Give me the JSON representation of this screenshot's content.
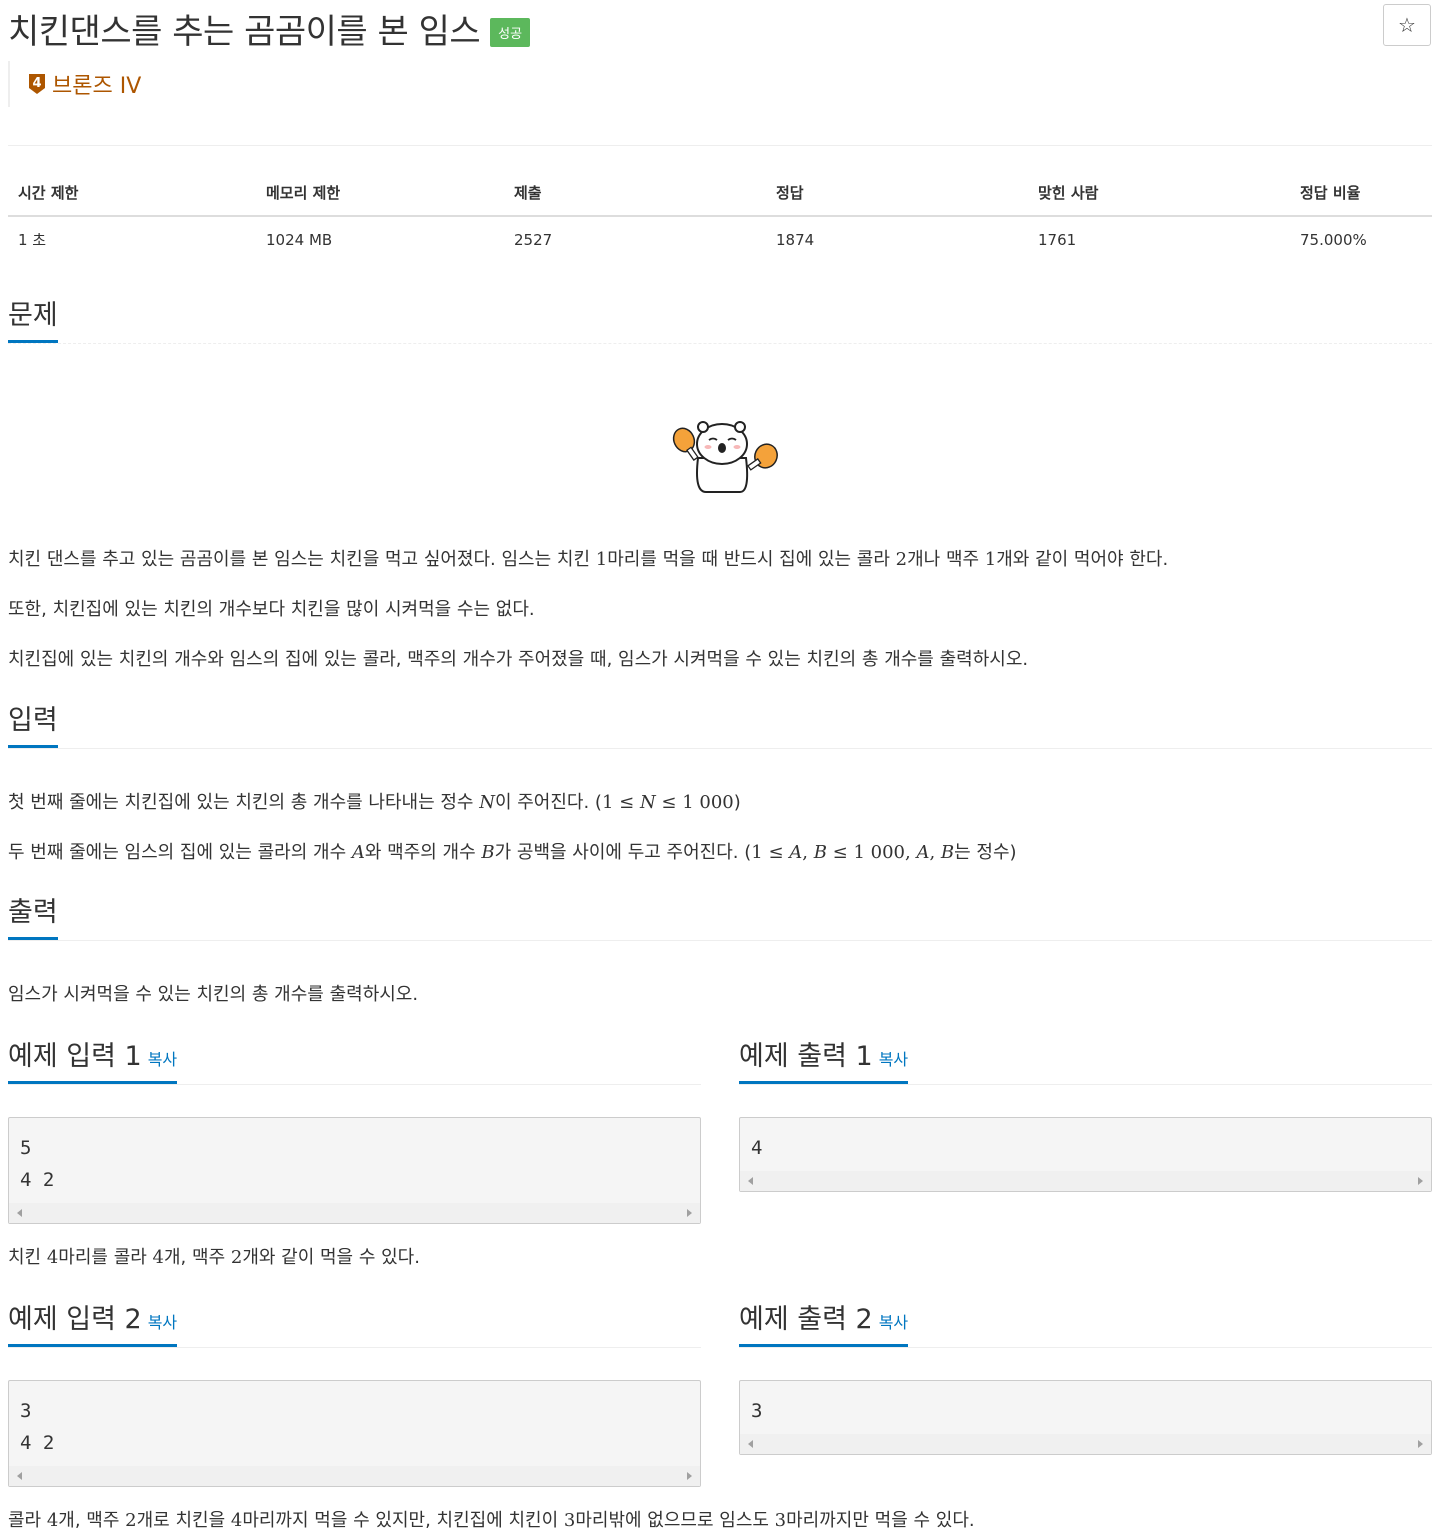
{
  "problem": {
    "title": "치킨댄스를 추는 곰곰이를 본 임스",
    "status_badge": "성공",
    "star_icon": "☆",
    "tier_number": "4",
    "tier_label": "브론즈 IV"
  },
  "stats": {
    "headers": [
      "시간 제한",
      "메모리 제한",
      "제출",
      "정답",
      "맞힌 사람",
      "정답 비율"
    ],
    "values": [
      "1 초",
      "1024 MB",
      "2527",
      "1874",
      "1761",
      "75.000%"
    ]
  },
  "sections": {
    "description_title": "문제",
    "description": {
      "p1a": "치킨 댄스를 추고 있는 곰곰이를 본 임스는 치킨을 먹고 싶어졌다. 임스는 치킨 ",
      "p1b": "1",
      "p1c": "마리를 먹을 때 반드시 집에 있는 콜라 ",
      "p1d": "2",
      "p1e": "개나 맥주 ",
      "p1f": "1",
      "p1g": "개와 같이 먹어야 한다.",
      "p2": "또한, 치킨집에 있는 치킨의 개수보다 치킨을 많이 시켜먹을 수는 없다.",
      "p3": "치킨집에 있는 치킨의 개수와 임스의 집에 있는 콜라, 맥주의 개수가 주어졌을 때, 임스가 시켜먹을 수 있는 치킨의 총 개수를 출력하시오."
    },
    "input_title": "입력",
    "input": {
      "l1a": "첫 번째 줄에는 치킨집에 있는 치킨의 총 개수를 나타내는 정수 ",
      "l1b": "N",
      "l1c": "이 주어진다. (",
      "l1d": "1 ≤ ",
      "l1e": "N",
      "l1f": " ≤ 1 000",
      "l1g": ")",
      "l2a": "두 번째 줄에는 임스의 집에 있는 콜라의 개수 ",
      "l2b": "A",
      "l2c": "와 맥주의 개수 ",
      "l2d": "B",
      "l2e": "가 공백을 사이에 두고 주어진다. (",
      "l2f": "1 ≤ ",
      "l2g": "A",
      "l2h": ", ",
      "l2i": "B",
      "l2j": " ≤ 1 000, ",
      "l2k": "A",
      "l2l": ", ",
      "l2m": "B",
      "l2n": "는 정수)"
    },
    "output_title": "출력",
    "output": "임스가 시켜먹을 수 있는 치킨의 총 개수를 출력하시오."
  },
  "examples": [
    {
      "input_title": "예제 입력 1",
      "output_title": "예제 출력 1",
      "copy_label": "복사",
      "input": "5\n4 2",
      "output": "4",
      "explain_a": "치킨 ",
      "explain_b": "4",
      "explain_c": "마리를 콜라 ",
      "explain_d": "4",
      "explain_e": "개, 맥주 ",
      "explain_f": "2",
      "explain_g": "개와 같이 먹을 수 있다."
    },
    {
      "input_title": "예제 입력 2",
      "output_title": "예제 출력 2",
      "copy_label": "복사",
      "input": "3\n4 2",
      "output": "3",
      "explain_a": "콜라 ",
      "explain_b": "4",
      "explain_c": "개, 맥주 ",
      "explain_d": "2",
      "explain_e": "개로 치킨을 ",
      "explain_f": "4",
      "explain_g": "마리까지 먹을 수 있지만, 치킨집에 치킨이 ",
      "explain_h": "3",
      "explain_i": "마리밖에 없으므로 임스도 ",
      "explain_j": "3",
      "explain_k": "마리까지만 먹을 수 있다."
    }
  ],
  "colors": {
    "accent": "#0076c0",
    "success": "#5cb85c",
    "bronze": "#ad5600"
  },
  "icons": {
    "star": "star-icon",
    "tier": "bronze-tier-icon",
    "illustration": "bear-chicken-illustration"
  }
}
